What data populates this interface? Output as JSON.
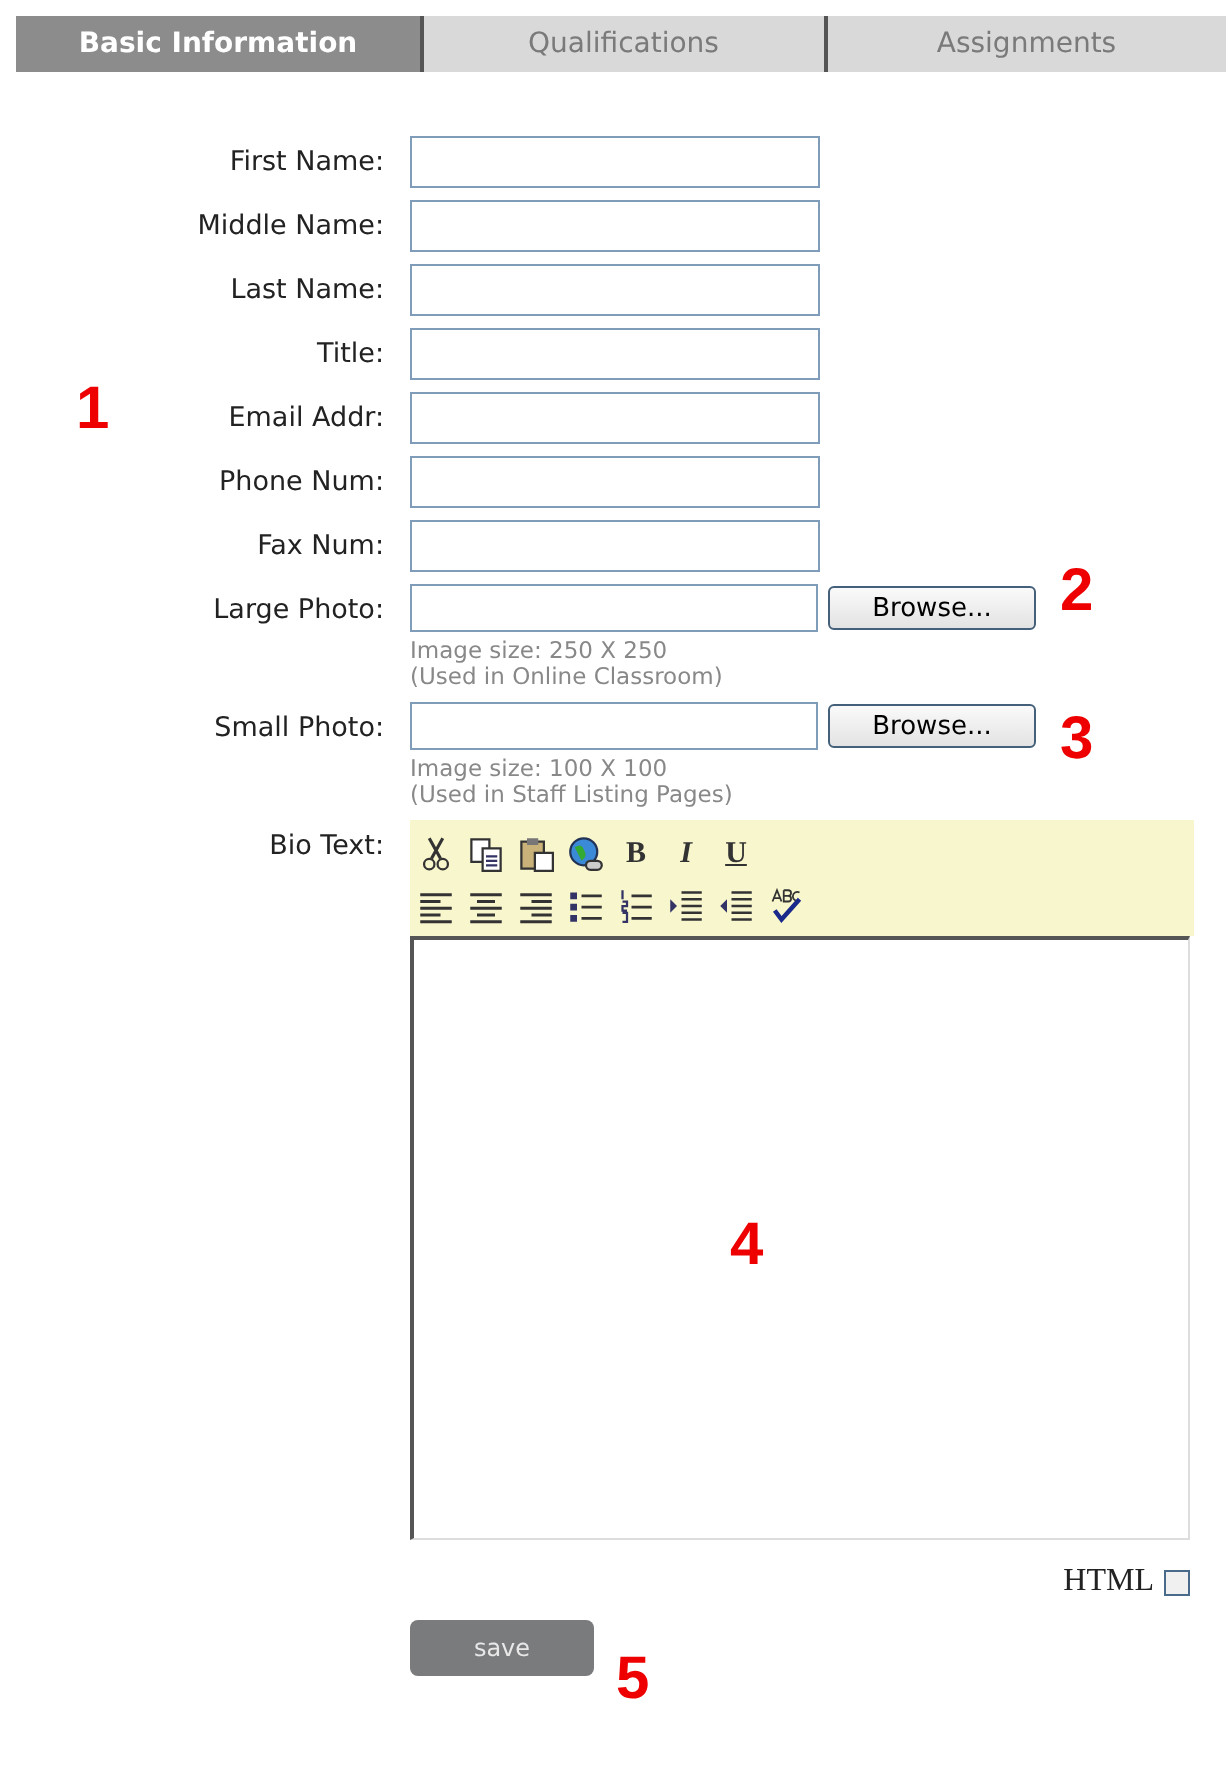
{
  "tabs": [
    {
      "label": "Basic Information",
      "selected": true
    },
    {
      "label": "Qualifications",
      "selected": false
    },
    {
      "label": "Assignments",
      "selected": false
    }
  ],
  "fields": [
    {
      "label": "First Name:",
      "kind": "text"
    },
    {
      "label": "Middle Name:",
      "kind": "text"
    },
    {
      "label": "Last Name:",
      "kind": "text"
    },
    {
      "label": "Title:",
      "kind": "text"
    },
    {
      "label": "Email Addr:",
      "kind": "text"
    },
    {
      "label": "Phone Num:",
      "kind": "text"
    },
    {
      "label": "Fax Num:",
      "kind": "text"
    },
    {
      "label": "Large Photo:",
      "kind": "file",
      "button": "Browse...",
      "hints": [
        "Image size: 250 X 250",
        "(Used in Online Classroom)"
      ]
    },
    {
      "label": "Small Photo:",
      "kind": "file",
      "button": "Browse...",
      "hints": [
        "Image size: 100 X 100",
        "(Used in Staff Listing Pages)"
      ]
    }
  ],
  "bio": {
    "label": "Bio Text:",
    "format_buttons": [
      "B",
      "I",
      "U"
    ]
  },
  "html_toggle": {
    "label": "HTML",
    "checked": false
  },
  "save_button": "save",
  "callouts": [
    "1",
    "2",
    "3",
    "4",
    "5"
  ]
}
